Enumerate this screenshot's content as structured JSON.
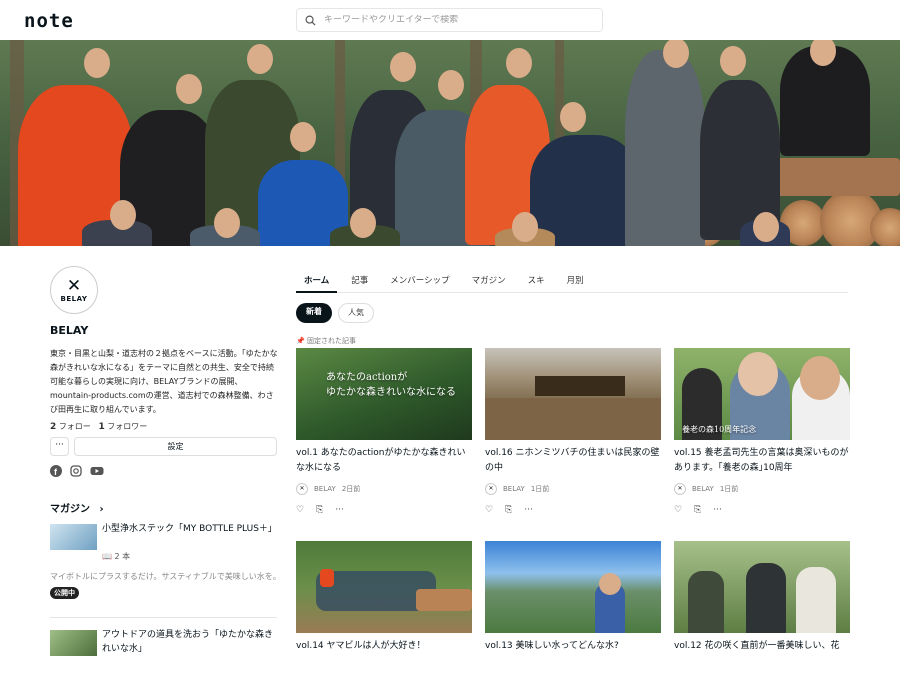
{
  "header": {
    "logo": "note",
    "search_placeholder": "キーワードやクリエイターで検索"
  },
  "profile": {
    "avatar_text": "BELAY",
    "name": "BELAY",
    "bio": "東京・目黒と山梨・道志村の２拠点をベースに活動。「ゆたかな森がきれいな水になる」をテーマに自然との共生、安全で持続可能な暮らしの実現に向け、BELAYブランドの展開、mountain-products.comの運営、道志村での森林整備、わさび田再生に取り組んでいます。",
    "follow_count": "2",
    "follow_label": "フォロー",
    "follower_count": "1",
    "follower_label": "フォロワー",
    "more_label": "···",
    "settings_label": "設定",
    "socials": [
      "facebook-icon",
      "instagram-icon",
      "youtube-icon"
    ]
  },
  "magazines": {
    "heading": "マガジン",
    "items": [
      {
        "title": "小型浄水ステック「MY BOTTLE PLUS＋」",
        "count": "2 本",
        "desc": "マイボトルにプラスするだけ。サスティナブルで美味しい水を。",
        "badge": "公開中"
      },
      {
        "title": "アウトドアの道具を洗おう「ゆたかな森きれいな水」"
      }
    ]
  },
  "tabs": [
    "ホーム",
    "記事",
    "メンバーシップ",
    "マガジン",
    "スキ",
    "月別"
  ],
  "sort": {
    "new": "新着",
    "popular": "人気"
  },
  "pinned_label": "固定された記事",
  "cards": [
    {
      "title": "vol.1 あなたのactionがゆたかな森きれいな水になる",
      "author": "BELAY",
      "date": "2日前",
      "thumb_text": "あなたのactionが\nゆたかな森きれいな水になる"
    },
    {
      "title": "vol.16 ニホンミツバチの住まいは民家の壁の中",
      "author": "BELAY",
      "date": "1日前"
    },
    {
      "title": "vol.15 養老孟司先生の言葉は奥深いものがあります。｢養老の森｣10周年",
      "author": "BELAY",
      "date": "1日前",
      "thumb_text": "養老の森10周年記念"
    },
    {
      "title": "vol.14 ヤマビルは人が大好き！"
    },
    {
      "title": "vol.13 美味しい水ってどんな水?"
    },
    {
      "title": "vol.12 花の咲く直前が一番美味しい、花"
    }
  ],
  "actions": {
    "like": "♡",
    "save": "⎘",
    "more": "···"
  }
}
